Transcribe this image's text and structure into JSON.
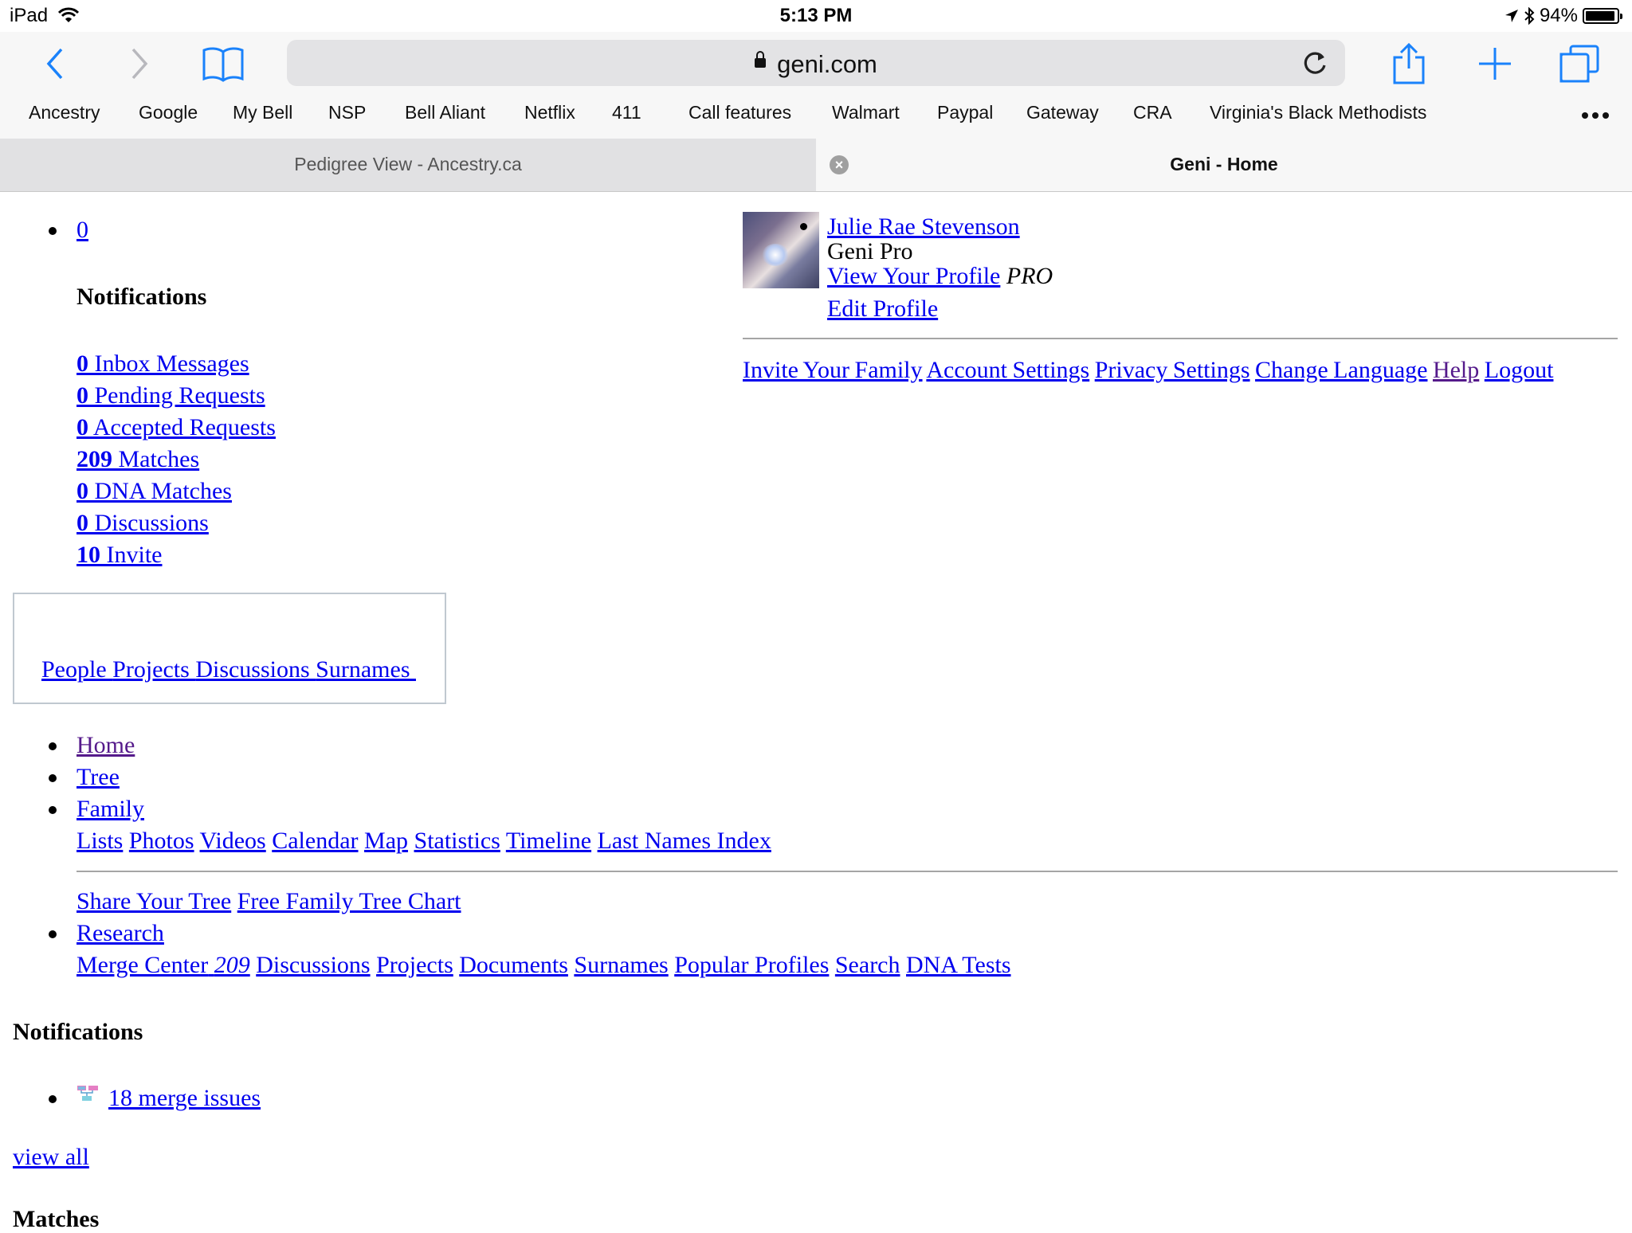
{
  "status_bar": {
    "device": "iPad",
    "time": "5:13 PM",
    "battery": "94%"
  },
  "toolbar": {
    "url": "geni.com"
  },
  "bookmarks": [
    "Ancestry",
    "Google",
    "My Bell",
    "NSP",
    "Bell Aliant",
    "Netflix",
    "411",
    "Call features",
    "Walmart",
    "Paypal",
    "Gateway",
    "CRA",
    "Virginia's Black Methodists"
  ],
  "tabs": [
    {
      "title": "Pedigree View - Ancestry.ca",
      "active": false
    },
    {
      "title": "Geni - Home",
      "active": true
    }
  ],
  "top_count": "0",
  "notifications_heading": "Notifications",
  "notifications": [
    {
      "count": "0",
      "label": " Inbox Messages"
    },
    {
      "count": "0",
      "label": " Pending Requests"
    },
    {
      "count": "0",
      "label": " Accepted Requests"
    },
    {
      "count": "209",
      "label": " Matches"
    },
    {
      "count": "0",
      "label": " DNA Matches"
    },
    {
      "count": "0",
      "label": " Discussions"
    },
    {
      "count": "10",
      "label": " Invite"
    }
  ],
  "search_nav": [
    "People ",
    "Projects ",
    "Discussions ",
    "Surnames "
  ],
  "profile": {
    "name": "Julie Rae Stevenson",
    "membership": "Geni Pro",
    "view_profile": "View Your Profile",
    "pro_badge": "PRO",
    "edit_profile": "Edit Profile"
  },
  "account_links": [
    "Invite Your Family",
    "Account Settings",
    "Privacy Settings",
    "Change Language",
    "Help",
    "Logout"
  ],
  "main_nav": {
    "home": "Home",
    "tree": "Tree",
    "family": "Family",
    "family_links": [
      "Lists",
      "Photos",
      "Videos",
      "Calendar",
      "Map",
      "Statistics",
      "Timeline",
      "Last Names Index"
    ],
    "share_links": [
      "Share Your Tree",
      "Free Family Tree Chart"
    ],
    "research": "Research",
    "research_merge": "Merge Center",
    "research_merge_count": "209",
    "research_links": [
      "Discussions",
      "Projects",
      "Documents",
      "Surnames",
      "Popular Profiles",
      "Search",
      "DNA Tests"
    ]
  },
  "notifications2_heading": "Notifications",
  "merge_issues": "18 merge issues",
  "view_all": "view all",
  "matches_heading": "Matches",
  "colors": {
    "link": "#0000ee",
    "visited": "#551a8b",
    "safari_blue": "#1a82fb"
  }
}
